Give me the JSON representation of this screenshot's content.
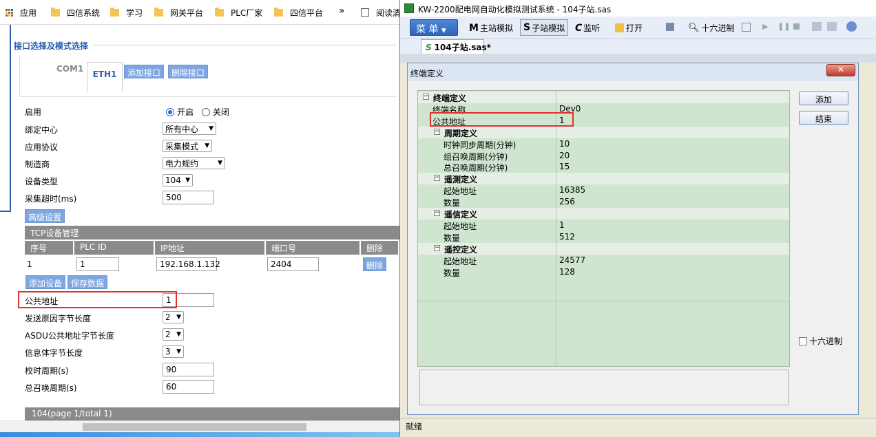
{
  "browser": {
    "bookmarks": [
      {
        "label": "应用",
        "icon": "apps-grid-icon"
      },
      {
        "label": "四信系统",
        "icon": "folder-icon"
      },
      {
        "label": "学习",
        "icon": "folder-icon"
      },
      {
        "label": "网关平台",
        "icon": "folder-icon"
      },
      {
        "label": "PLC厂家",
        "icon": "folder-icon"
      },
      {
        "label": "四信平台",
        "icon": "folder-icon"
      }
    ],
    "more_label": "»",
    "reading_label": "阅读清"
  },
  "form": {
    "section_title": "接口选择及模式选择",
    "tabs": [
      {
        "label": "COM1"
      },
      {
        "label": "ETH1"
      }
    ],
    "add_iface_label": "添加接口",
    "del_iface_label": "删除接口",
    "enable": {
      "label": "启用",
      "on": "开启",
      "off": "关闭"
    },
    "bind_center": {
      "label": "绑定中心",
      "value": "所有中心"
    },
    "protocol": {
      "label": "应用协议",
      "value": "采集模式"
    },
    "vendor": {
      "label": "制造商",
      "value": "电力规约"
    },
    "device_type": {
      "label": "设备类型",
      "value": "104"
    },
    "timeout": {
      "label": "采集超时(ms)",
      "value": "500"
    },
    "advanced_label": "高级设置",
    "tcp_title": "TCP设备管理",
    "table_headers": [
      "序号",
      "PLC ID",
      "IP地址",
      "端口号",
      "删除"
    ],
    "table_row": {
      "idx": "1",
      "plc_id": "1",
      "ip": "192.168.1.132",
      "port": "2404",
      "del": "删除"
    },
    "add_device_label": "添加设备",
    "save_data_label": "保存数据",
    "common_addr": {
      "label": "公共地址",
      "value": "1"
    },
    "cause_len": {
      "label": "发送原因字节长度",
      "value": "2"
    },
    "asdu_len": {
      "label": "ASDU公共地址字节长度",
      "value": "2"
    },
    "info_len": {
      "label": "信息体字节长度",
      "value": "3"
    },
    "clock_period": {
      "label": "校时周期(s)",
      "value": "90"
    },
    "gi_period": {
      "label": "总召唤周期(s)",
      "value": "60"
    },
    "footer": "104(page 1/total 1)"
  },
  "app": {
    "title": "KW-2200配电网自动化模拟测试系统 - 104子站.sas",
    "menu_label": "菜 单",
    "toolbar": {
      "master": "主站模拟",
      "slave": "子站模拟",
      "monitor": "监听",
      "open": "打开",
      "hex": "十六进制"
    },
    "doc_tab": "104子站.sas*",
    "status": "就绪",
    "dialog": {
      "title": "终端定义",
      "add_label": "添加",
      "end_label": "结束",
      "hex_checkbox": "十六进制",
      "rows": [
        {
          "type": "group",
          "label": "终端定义",
          "indent": 0
        },
        {
          "type": "item",
          "label": "终端名称",
          "value": "Dev0",
          "indent": 0
        },
        {
          "type": "item",
          "label": "公共地址",
          "value": "1",
          "indent": 0
        },
        {
          "type": "group",
          "label": "周期定义",
          "indent": 1
        },
        {
          "type": "item",
          "label": "时钟同步周期(分钟)",
          "value": "10",
          "indent": 1
        },
        {
          "type": "item",
          "label": "组召唤周期(分钟)",
          "value": "20",
          "indent": 1
        },
        {
          "type": "item",
          "label": "总召唤周期(分钟)",
          "value": "15",
          "indent": 1
        },
        {
          "type": "group",
          "label": "遥测定义",
          "indent": 1
        },
        {
          "type": "item",
          "label": "起始地址",
          "value": "16385",
          "indent": 1
        },
        {
          "type": "item",
          "label": "数量",
          "value": "256",
          "indent": 1
        },
        {
          "type": "group",
          "label": "遥信定义",
          "indent": 1
        },
        {
          "type": "item",
          "label": "起始地址",
          "value": "1",
          "indent": 1
        },
        {
          "type": "item",
          "label": "数量",
          "value": "512",
          "indent": 1
        },
        {
          "type": "group",
          "label": "遥控定义",
          "indent": 1
        },
        {
          "type": "item",
          "label": "起始地址",
          "value": "24577",
          "indent": 1
        },
        {
          "type": "item",
          "label": "数量",
          "value": "128",
          "indent": 1
        }
      ]
    }
  },
  "colors": {
    "highlight": "#e03030",
    "grid_green": "#cfe5cf",
    "web_button": "#7ea6e0"
  }
}
